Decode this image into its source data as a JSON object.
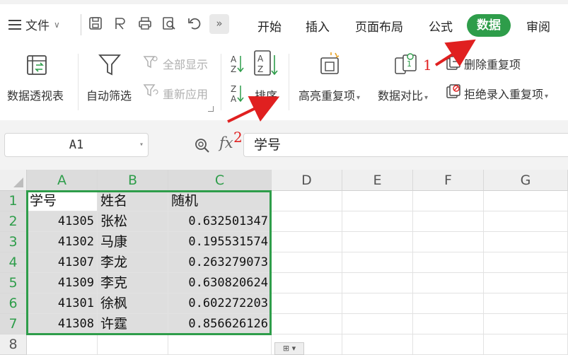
{
  "menubar": {
    "file_label": "文件",
    "tabs": [
      "开始",
      "插入",
      "页面布局",
      "公式"
    ],
    "active_tab": "数据",
    "tab_review": "审阅"
  },
  "ribbon": {
    "pivot": "数据透视表",
    "autofilter": "自动筛选",
    "show_all": "全部显示",
    "reapply": "重新应用",
    "sort": "排序",
    "highlight_dup": "高亮重复项",
    "compare": "数据对比",
    "delete_dup": "删除重复项",
    "reject_dup": "拒绝录入重复项"
  },
  "formula_bar": {
    "name_box": "A1",
    "fx": "fx",
    "value": "学号"
  },
  "grid": {
    "columns": [
      "A",
      "B",
      "C",
      "D",
      "E",
      "F",
      "G"
    ],
    "rows": [
      "1",
      "2",
      "3",
      "4",
      "5",
      "6",
      "7",
      "8"
    ],
    "header": [
      "学号",
      "姓名",
      "随机"
    ],
    "data": [
      [
        "41305",
        "张松",
        "0.632501347"
      ],
      [
        "41302",
        "马康",
        "0.195531574"
      ],
      [
        "41307",
        "李龙",
        "0.263279073"
      ],
      [
        "41309",
        "李克",
        "0.630820624"
      ],
      [
        "41301",
        "徐枫",
        "0.602272203"
      ],
      [
        "41308",
        "许霆",
        "0.856626126"
      ]
    ]
  },
  "annotations": {
    "step1": "1",
    "step2": "2",
    "color": "#e02020"
  },
  "colors": {
    "accent": "#2e9d4a",
    "selection_fill": "#dedede"
  }
}
